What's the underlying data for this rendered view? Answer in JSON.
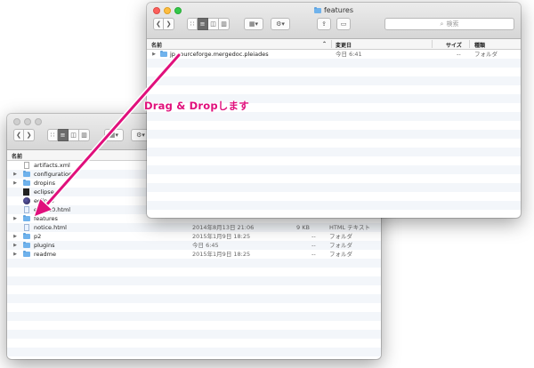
{
  "front_window": {
    "title": "features",
    "search_placeholder": "検索",
    "columns": {
      "name": "名前",
      "modified": "変更日",
      "size": "サイズ",
      "kind": "種類"
    },
    "rows": [
      {
        "name": "jp.sourceforge.mergedoc.pleiades",
        "modified": "今日 6:41",
        "size": "--",
        "kind": "フォルダ",
        "icon": "folder-icon"
      }
    ]
  },
  "back_window": {
    "columns": {
      "name": "名前"
    },
    "rows": [
      {
        "name": "artifacts.xml",
        "modified": "",
        "size": "",
        "kind": "",
        "icon": "file-icon",
        "disclosure": false
      },
      {
        "name": "configuration",
        "modified": "",
        "size": "",
        "kind": "",
        "icon": "folder-icon",
        "disclosure": true
      },
      {
        "name": "dropins",
        "modified": "",
        "size": "",
        "kind": "",
        "icon": "folder-icon",
        "disclosure": true
      },
      {
        "name": "eclipse",
        "modified": "",
        "size": "",
        "kind": "",
        "icon": "exec-icon",
        "disclosure": false
      },
      {
        "name": "eclipse",
        "modified": "",
        "size": "",
        "kind": "",
        "icon": "app-icon",
        "disclosure": false
      },
      {
        "name": "epl-v10.html",
        "modified": "",
        "size": "",
        "kind": "",
        "icon": "html-icon",
        "disclosure": false
      },
      {
        "name": "features",
        "modified": "",
        "size": "",
        "kind": "",
        "icon": "folder-icon",
        "disclosure": true
      },
      {
        "name": "notice.html",
        "modified": "2014年8月13日 21:06",
        "size": "9 KB",
        "kind": "HTML テキスト",
        "icon": "html-icon",
        "disclosure": false
      },
      {
        "name": "p2",
        "modified": "2015年1月9日 18:25",
        "size": "--",
        "kind": "フォルダ",
        "icon": "folder-icon",
        "disclosure": true
      },
      {
        "name": "plugins",
        "modified": "今日 6:45",
        "size": "--",
        "kind": "フォルダ",
        "icon": "folder-icon",
        "disclosure": true
      },
      {
        "name": "readme",
        "modified": "2015年1月9日 18:25",
        "size": "--",
        "kind": "フォルダ",
        "icon": "folder-icon",
        "disclosure": true
      }
    ]
  },
  "toolbar_icons": {
    "back": "chevron-left-icon",
    "forward": "chevron-right-icon",
    "icon_view": "icon-view-icon",
    "list_view": "list-view-icon",
    "column_view": "column-view-icon",
    "coverflow_view": "coverflow-view-icon",
    "arrange": "arrange-icon",
    "action": "gear-icon",
    "share": "share-icon",
    "tags": "tag-icon",
    "search": "search-icon"
  },
  "annotation": {
    "caption": "Drag & Dropします",
    "color": "#e0107c"
  }
}
